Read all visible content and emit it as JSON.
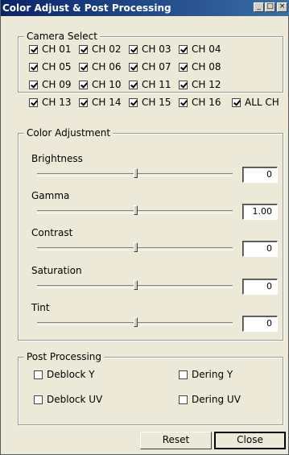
{
  "window": {
    "title": "Color Adjust & Post Processing",
    "buttons": {
      "minimize": "_",
      "maximize": "□",
      "close": "×"
    }
  },
  "camera_select": {
    "legend": "Camera Select",
    "channels": [
      {
        "label": "CH 01",
        "checked": true
      },
      {
        "label": "CH 02",
        "checked": true
      },
      {
        "label": "CH 03",
        "checked": true
      },
      {
        "label": "CH 04",
        "checked": true
      },
      {
        "label": "CH 05",
        "checked": true
      },
      {
        "label": "CH 06",
        "checked": true
      },
      {
        "label": "CH 07",
        "checked": true
      },
      {
        "label": "CH 08",
        "checked": true
      },
      {
        "label": "CH 09",
        "checked": true
      },
      {
        "label": "CH 10",
        "checked": true
      },
      {
        "label": "CH 11",
        "checked": true
      },
      {
        "label": "CH 12",
        "checked": true
      },
      {
        "label": "CH 13",
        "checked": true
      },
      {
        "label": "CH 14",
        "checked": true
      },
      {
        "label": "CH 15",
        "checked": true
      },
      {
        "label": "CH 16",
        "checked": true
      }
    ],
    "all": {
      "label": "ALL CH",
      "checked": true
    }
  },
  "color_adjustment": {
    "legend": "Color Adjustment",
    "sliders": [
      {
        "label": "Brightness",
        "value": "0",
        "position": 0.5
      },
      {
        "label": "Gamma",
        "value": "1.00",
        "position": 0.5
      },
      {
        "label": "Contrast",
        "value": "0",
        "position": 0.5
      },
      {
        "label": "Saturation",
        "value": "0",
        "position": 0.5
      },
      {
        "label": "Tint",
        "value": "0",
        "position": 0.5
      }
    ]
  },
  "post_processing": {
    "legend": "Post Processing",
    "options": [
      {
        "label": "Deblock Y",
        "checked": false
      },
      {
        "label": "Dering Y",
        "checked": false
      },
      {
        "label": "Deblock UV",
        "checked": false
      },
      {
        "label": "Dering UV",
        "checked": false
      }
    ]
  },
  "footer": {
    "reset_label": "Reset",
    "close_label": "Close"
  }
}
